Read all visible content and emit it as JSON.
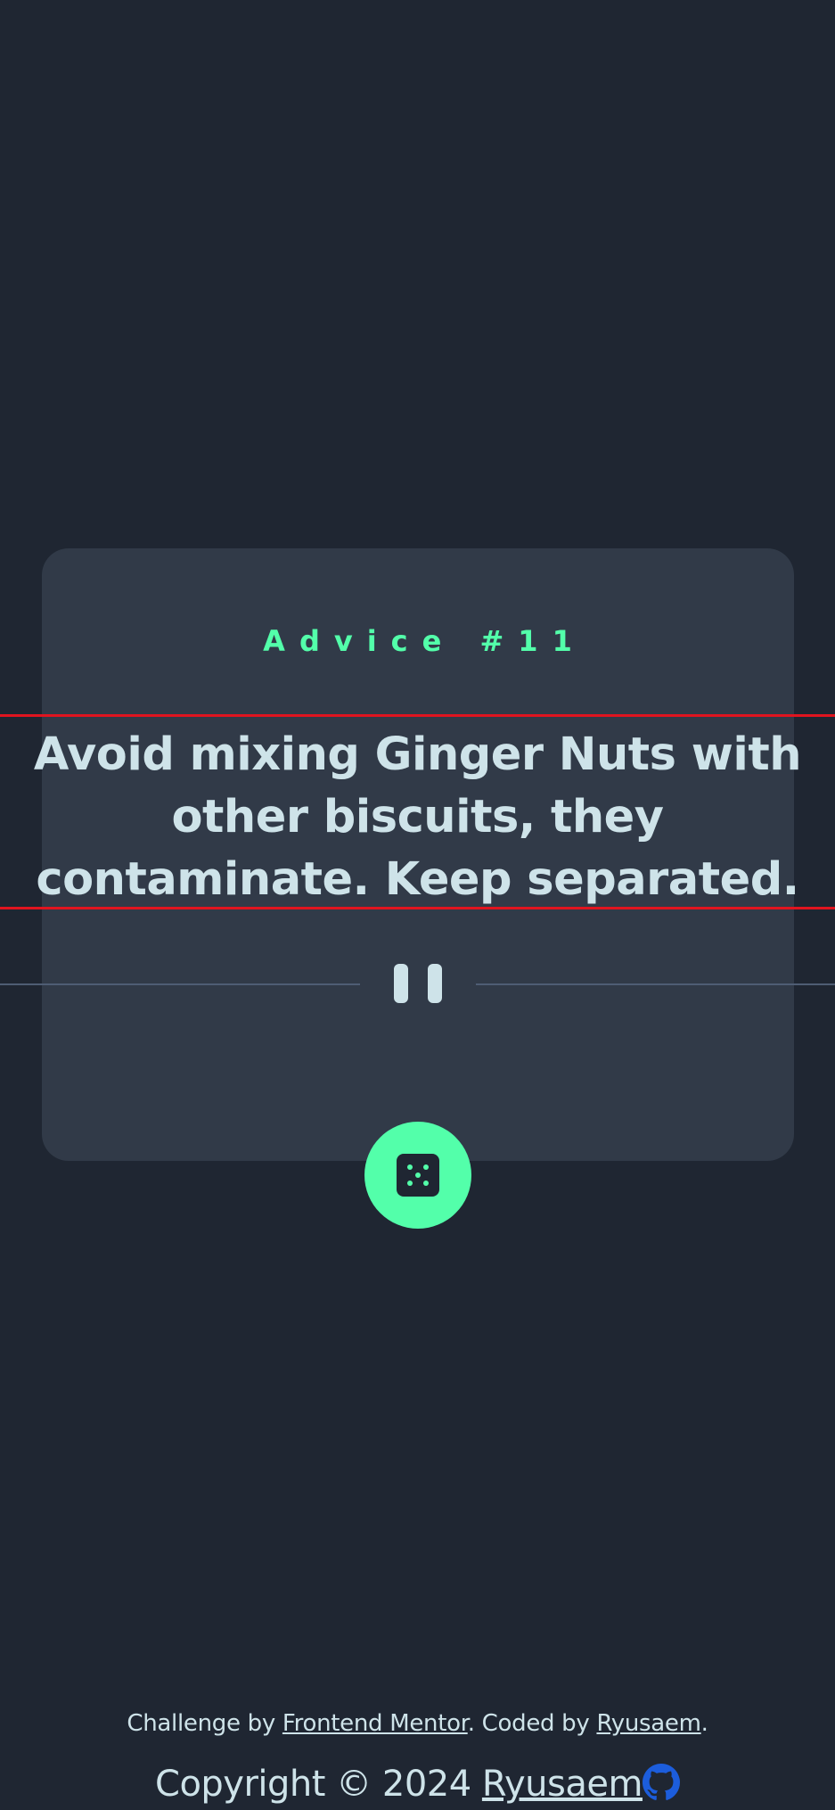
{
  "advice": {
    "id_label": "Advice #11",
    "text": "Avoid mixing Ginger Nuts with other biscuits, they contaminate. Keep separated."
  },
  "divider": {
    "icon": "pause-icon"
  },
  "generate_button": {
    "icon": "dice-icon"
  },
  "footer": {
    "challenge_prefix": "Challenge by ",
    "challenge_link": "Frontend Mentor",
    "coded_by_prefix": ". Coded by ",
    "coded_by_link": "Ryusaem",
    "coded_by_suffix": ".",
    "copyright_text": "Copyright © 2024 ",
    "copyright_link": "Ryusaem",
    "github_icon": "github-icon"
  },
  "colors": {
    "background": "#1f2632",
    "card": "#313a48",
    "accent": "#53ffaa",
    "text": "#cee3e9",
    "divider": "#4f5d74",
    "github": "#1c5ddc"
  }
}
